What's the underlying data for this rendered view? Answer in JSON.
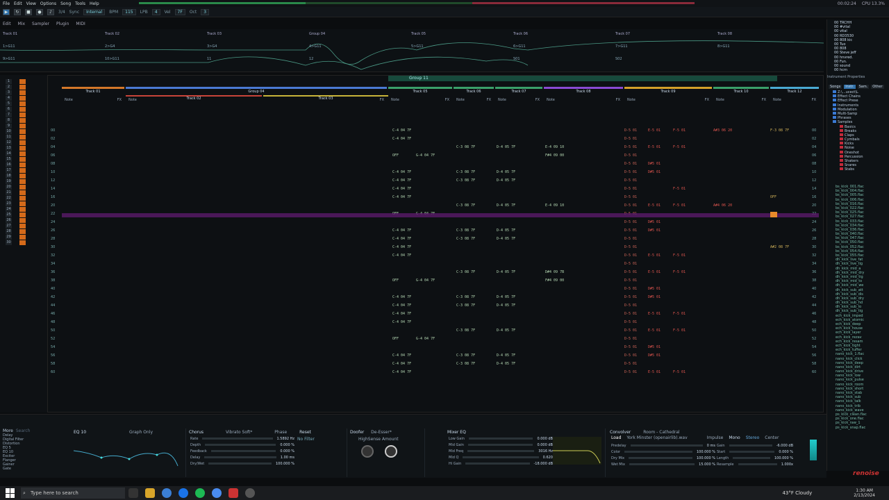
{
  "menu": [
    "File",
    "Edit",
    "View",
    "Options",
    "Song",
    "Tools",
    "Help"
  ],
  "status": {
    "time": "00:02:24",
    "cpu": "CPU 13.3%"
  },
  "transport": {
    "sync_label": "Sync",
    "sync_value": "Internal",
    "bpm_label": "BPM",
    "bpm_value": "115",
    "lpb_label": "LPB",
    "lpb_value": "4",
    "vel_label": "Vel",
    "vel_value": "7F",
    "oct_label": "Oct",
    "oct_value": "3",
    "sig": "3/4"
  },
  "modes": [
    "Edit",
    "Mix",
    "Sampler",
    "Plugin",
    "MIDI"
  ],
  "scope_tracks": [
    {
      "name": "Track 01",
      "sub": "1>G11",
      "sub2": "9>G11"
    },
    {
      "name": "Track 02",
      "sub": "2>G4",
      "sub2": "10>G11"
    },
    {
      "name": "Track 03",
      "sub": "3>G4",
      "sub2": "11"
    },
    {
      "name": "Group 04",
      "sub": "4>G11",
      "sub2": "12"
    },
    {
      "name": "Track 05",
      "sub": "5>G11",
      "sub2": ""
    },
    {
      "name": "Track 06",
      "sub": "6>G11",
      "sub2": "S01"
    },
    {
      "name": "Track 07",
      "sub": "7>G11",
      "sub2": "S02"
    },
    {
      "name": "Track 08",
      "sub": "8>G11",
      "sub2": ""
    }
  ],
  "pattern": {
    "group_header": "Group 11",
    "tracks": [
      "Track 01",
      "Group 04",
      "Track 05",
      "Track 06",
      "Track 07",
      "Track 08",
      "Track 09",
      "Track 10",
      "Track 12"
    ],
    "sub_tracks": [
      "Track 02",
      "Track 03"
    ],
    "col_label": "Note",
    "fx_label": "FX",
    "rows": [
      {
        "n": "00",
        "a": "C-4 04 7F",
        "b": "D-5 01",
        "c": "E-5 01",
        "d": "F-5 01",
        "e": "A#3 06 20",
        "f": "F-3 08 7F"
      },
      {
        "n": "02",
        "a": "C-4 04 7F",
        "b": "D-5 01"
      },
      {
        "n": "04",
        "a": "",
        "g": "C-3 08 7F",
        "h": "D-4 05 7F",
        "i": "E-4 09 10",
        "b": "D-5 01",
        "c": "E-5 01",
        "d": "F-5 01"
      },
      {
        "n": "06",
        "a": "OFF",
        "x": "G-4 04 7F",
        "i": "F#4 09 00",
        "b": "D-5 01"
      },
      {
        "n": "08",
        "b": "D-5 01",
        "c": "D#5 01"
      },
      {
        "n": "10",
        "a": "C-4 04 7F",
        "g": "C-3 08 7F",
        "h": "D-4 05 7F",
        "b": "D-5 01",
        "c": "D#5 01"
      },
      {
        "n": "12",
        "a": "C-4 04 7F",
        "g": "C-3 08 7F",
        "h": "D-4 05 7F",
        "b": "D-5 01"
      },
      {
        "n": "14",
        "a": "C-4 04 7F",
        "b": "D-5 01",
        "d": "F-5 01"
      },
      {
        "n": "16",
        "a": "C-4 04 7F",
        "b": "D-5 01",
        "f": "OFF"
      },
      {
        "n": "20",
        "a": "",
        "g": "C-3 08 7F",
        "h": "D-4 05 7F",
        "i": "E-4 09 10",
        "b": "D-5 01",
        "c": "E-5 01",
        "d": "F-5 01",
        "e": "A#4 06 20"
      },
      {
        "n": "22",
        "a": "OFF",
        "x": "G-4 04 7F",
        "b": "D-5 01"
      },
      {
        "n": "24",
        "b": "D-5 01",
        "c": "D#5 01"
      },
      {
        "n": "26",
        "a": "C-4 04 7F",
        "g": "C-3 08 7F",
        "h": "D-4 05 7F",
        "b": "D-5 01",
        "c": "D#5 01"
      },
      {
        "n": "28",
        "a": "C-4 04 7F",
        "g": "C-3 08 7F",
        "h": "D-4 05 7F",
        "b": "D-5 01"
      },
      {
        "n": "30",
        "a": "C-4 04 7F",
        "b": "D-5 01",
        "f": "A#2 08 7F"
      },
      {
        "n": "32",
        "a": "C-4 04 7F",
        "b": "D-5 01",
        "c": "E-5 01",
        "d": "F-5 01"
      },
      {
        "n": "34",
        "b": "D-5 01"
      },
      {
        "n": "36",
        "a": "",
        "g": "C-3 08 7F",
        "h": "D-4 05 7F",
        "i": "D#4 09 7B",
        "b": "D-5 01",
        "c": "E-5 01",
        "d": "F-5 01"
      },
      {
        "n": "38",
        "a": "OFF",
        "x": "G-4 04 7F",
        "i": "F#4 09 00",
        "b": "D-5 01"
      },
      {
        "n": "40",
        "b": "D-5 01",
        "c": "D#5 01"
      },
      {
        "n": "42",
        "a": "C-4 04 7F",
        "g": "C-3 08 7F",
        "h": "D-4 05 7F",
        "b": "D-5 01",
        "c": "D#5 01"
      },
      {
        "n": "44",
        "a": "C-4 04 7F",
        "g": "C-3 08 7F",
        "h": "D-4 05 7F",
        "b": "D-5 01"
      },
      {
        "n": "46",
        "a": "C-4 04 7F",
        "b": "D-5 01",
        "c": "E-5 01",
        "d": "F-5 01"
      },
      {
        "n": "48",
        "a": "C-4 04 7F",
        "b": "D-5 01"
      },
      {
        "n": "50",
        "a": "",
        "g": "C-3 08 7F",
        "h": "D-4 05 7F",
        "b": "D-5 01",
        "c": "E-5 01",
        "d": "F-5 01"
      },
      {
        "n": "52",
        "a": "OFF",
        "x": "G-4 04 7F",
        "b": "D-5 01"
      },
      {
        "n": "54",
        "b": "D-5 01",
        "c": "D#5 01"
      },
      {
        "n": "56",
        "a": "C-4 04 7F",
        "g": "C-3 08 7F",
        "h": "D-4 05 7F",
        "b": "D-5 01",
        "c": "D#5 01"
      },
      {
        "n": "58",
        "a": "C-4 04 7F",
        "g": "C-3 08 7F",
        "h": "D-4 05 7F",
        "b": "D-5 01"
      },
      {
        "n": "60",
        "a": "C-4 04 7F",
        "b": "D-5 01",
        "c": "E-5 01",
        "d": "F-5 01"
      }
    ]
  },
  "dsp": {
    "list_title": "More",
    "search": "Search",
    "devices": [
      "Delay",
      "Digital Filter",
      "Distortion",
      "EQ 5",
      "EQ 10",
      "Exciter",
      "Flanger",
      "Gainer",
      "Gate"
    ],
    "eq": "EQ 10",
    "graph": "Graph Only",
    "chorus": {
      "title": "Chorus",
      "preset": "Vibrato Soft*",
      "params": [
        "Rate",
        "Depth",
        "Feedback",
        "Delay",
        "Dry/Wet"
      ],
      "values": [
        "1.5892 Hz",
        "0.000 %",
        "0.000 %",
        "1.00 ms",
        "100.000 %"
      ],
      "phase": "Phase",
      "filter": "No Filter",
      "reset": "Reset"
    },
    "doofer": {
      "title": "Doofer",
      "preset": "De-Esser*",
      "p1": "HighSense",
      "p2": "Amount"
    },
    "mixeq": {
      "title": "Mixer EQ",
      "params": [
        "Low Gain",
        "Mid Gain",
        "Mid Freq",
        "Mid Q",
        "Hi Gain"
      ],
      "values": [
        "0.000 dB",
        "0.000 dB",
        "3016 Hz",
        "0.620",
        "-18.000 dB"
      ]
    },
    "conv": {
      "title": "Convolver",
      "preset": "Room - Cathedral",
      "load": "Load",
      "file": "York Minster (openairlib).wav",
      "params": [
        "Predelay",
        "Color",
        "Dry Mix",
        "Wet Mix"
      ],
      "values": [
        "0 ms",
        "100.000 %",
        "100.000 %",
        "15.000 %"
      ],
      "params2": [
        "Gain",
        "Start",
        "Length",
        "Resample"
      ],
      "values2": [
        "-6.000 dB",
        "0.000 %",
        "100.000 %",
        "1.000x"
      ],
      "impulse": "Impulse",
      "mono": "Mono",
      "stereo": "Stereo",
      "center": "Center"
    }
  },
  "browser": {
    "tabs": [
      "Songs",
      "Instr.",
      "Sam.",
      "Other"
    ],
    "tree": [
      "Z:\\...ucect\\L",
      "Effect Chains",
      "Effect Prese",
      "Instruments",
      "Modulation",
      "Multi-Samp",
      "Phrases",
      "Samples",
      "Basics",
      "Breaks",
      "Claps",
      "Cymbals",
      "Kicks",
      "Noise",
      "Oneshot",
      "Percussion",
      "Shakers",
      "Snares",
      "Stabs"
    ],
    "files": [
      "bs_kick_001.flac",
      "bs_kick_004.flac",
      "bs_kick_005.flac",
      "bs_kick_006.flac",
      "bs_kick_016.flac",
      "bs_kick_022.flac",
      "bs_kick_025.flac",
      "bs_kick_027.flac",
      "bs_kick_033.flac",
      "bs_kick_034.flac",
      "bs_kick_036.flac",
      "bs_kick_040.flac",
      "bs_kick_047.flac",
      "bs_kick_050.flac",
      "bs_kick_052.flac",
      "bs_kick_054.flac",
      "bs_kick_055.flac",
      "dh_kick_live_fat",
      "dh_kick_live_tig",
      "dh_kick_mid_a",
      "dh_kick_mid_dry",
      "dh_kick_mid_tig",
      "dh_kick_mid_to",
      "dh_kick_mid_we",
      "dh_kick_sub_att",
      "dh_kick_sub_dis",
      "dh_kick_sub_dry",
      "dh_kick_sub_hd",
      "dh_kick_sub_lo",
      "dh_kick_sub_tig",
      "ech_kick_imped",
      "ech_kick_atomic",
      "ech_kick_deep",
      "ech_kick_house",
      "ech_kick_layer",
      "ech_kick_rezav",
      "ech_kick_resam",
      "ech_kick_tight",
      "ech_kick_tuffer",
      "nano_kick_1.flac",
      "nano_kick_click",
      "nano_kick_deep",
      "nano_kick_dirt",
      "nano_kick_drive",
      "nano_kick_low",
      "nano_kick_pulse",
      "nano_kick_room",
      "nano_kick_short",
      "nano_kick_stab",
      "nano_kick_sub",
      "nano_kick_talk",
      "nano_kick_trib",
      "nano_kick_wave",
      "ps_kick_clean.flac",
      "ps_kick_one.flac",
      "ps_kick_raw_1",
      "ps_kick_snap.flac"
    ],
    "inst": [
      "00 TRCHH",
      "00 #vital",
      "00 vital",
      "00 RD3530",
      "00 808 kic",
      "00 Tuo",
      "00 808",
      "00 Steve jeff",
      "00 hnvred.",
      "00 Fun.",
      "00 sound",
      "00 hcrn"
    ],
    "inst_title": "Instrument Properties"
  },
  "taskbar": {
    "search": "Type here to search",
    "weather": "43°F  Cloudy",
    "time": "1:30 AM",
    "date": "2/13/2024"
  },
  "logo": "renoise"
}
